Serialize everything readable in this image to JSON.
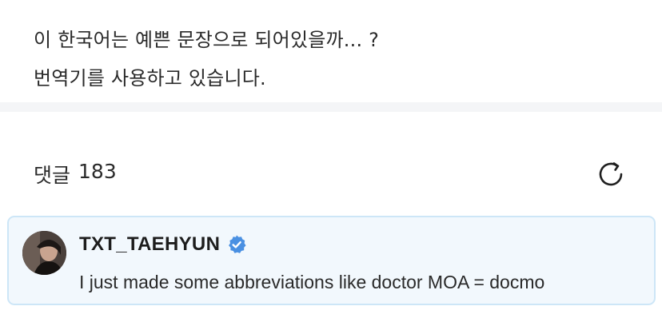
{
  "post": {
    "lines": [
      "이 한국어는 예쁜 문장으로 되어있을까... ?",
      "번역기를 사용하고 있습니다."
    ]
  },
  "comments": {
    "label": "댓글",
    "count": "183",
    "items": [
      {
        "author": "TXT_TAEHYUN",
        "verified": true,
        "text": "I just made some abbreviations like doctor MOA = docmo"
      }
    ]
  },
  "icons": {
    "refresh": "refresh-icon",
    "verified": "verified-badge-icon"
  },
  "colors": {
    "verified": "#4a90e2",
    "card_bg": "#f2f8fd",
    "card_border": "#cde6f7"
  }
}
